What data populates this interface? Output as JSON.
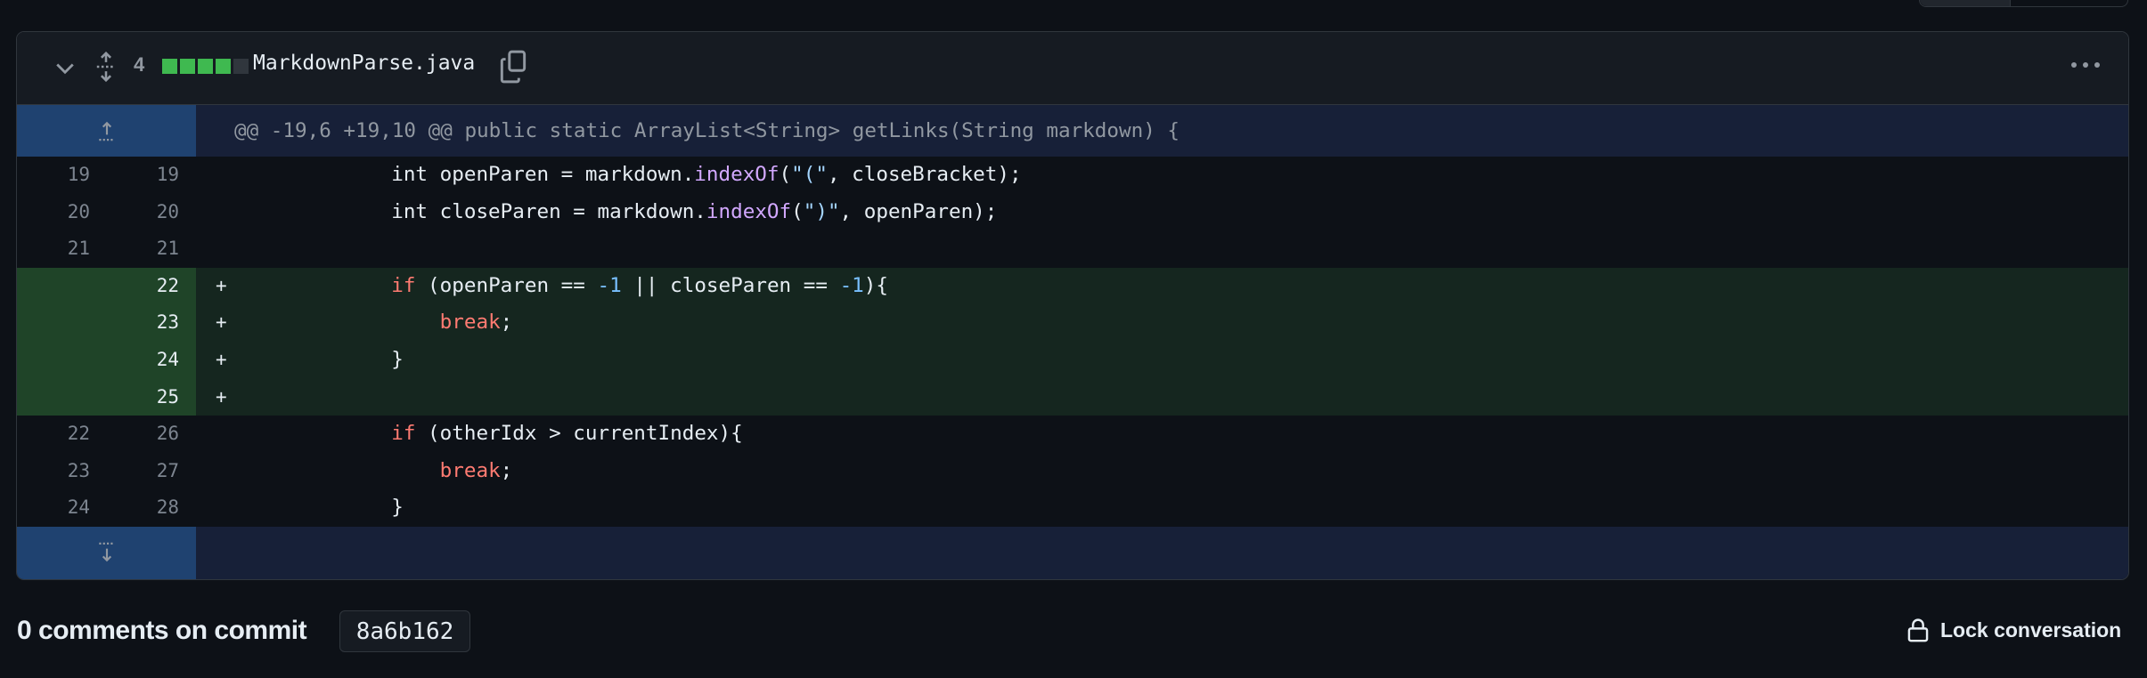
{
  "file": {
    "changes": "4",
    "diffstat": [
      "add",
      "add",
      "add",
      "add",
      "neutral"
    ],
    "name": "MarkdownParse.java",
    "icons": {
      "collapse": "chevron-down-icon",
      "expand": "unfold-icon",
      "copy": "copy-icon",
      "menu": "kebab-horizontal-icon"
    }
  },
  "hunk_header": "@@ -19,6 +19,10 @@ public static ArrayList<String> getLinks(String markdown) {",
  "lines": [
    {
      "old": "19",
      "new": "19",
      "type": "ctx",
      "marker": "",
      "tokens": [
        [
          "txt",
          "            int openParen = markdown."
        ],
        [
          "fn",
          "indexOf"
        ],
        [
          "txt",
          "("
        ],
        [
          "str",
          "\"(\""
        ],
        [
          "txt",
          ", closeBracket);"
        ]
      ]
    },
    {
      "old": "20",
      "new": "20",
      "type": "ctx",
      "marker": "",
      "tokens": [
        [
          "txt",
          "            int closeParen = markdown."
        ],
        [
          "fn",
          "indexOf"
        ],
        [
          "txt",
          "("
        ],
        [
          "str",
          "\")\""
        ],
        [
          "txt",
          ", openParen);"
        ]
      ]
    },
    {
      "old": "21",
      "new": "21",
      "type": "ctx",
      "marker": "",
      "tokens": [
        [
          "txt",
          ""
        ]
      ]
    },
    {
      "old": "",
      "new": "22",
      "type": "add",
      "marker": "+",
      "tokens": [
        [
          "txt",
          "            "
        ],
        [
          "kw",
          "if"
        ],
        [
          "txt",
          " (openParen == "
        ],
        [
          "num",
          "-1"
        ],
        [
          "txt",
          " || closeParen == "
        ],
        [
          "num",
          "-1"
        ],
        [
          "txt",
          "){"
        ]
      ]
    },
    {
      "old": "",
      "new": "23",
      "type": "add",
      "marker": "+",
      "tokens": [
        [
          "txt",
          "                "
        ],
        [
          "kw",
          "break"
        ],
        [
          "txt",
          ";"
        ]
      ]
    },
    {
      "old": "",
      "new": "24",
      "type": "add",
      "marker": "+",
      "tokens": [
        [
          "txt",
          "            }"
        ]
      ]
    },
    {
      "old": "",
      "new": "25",
      "type": "add",
      "marker": "+",
      "tokens": [
        [
          "txt",
          ""
        ]
      ]
    },
    {
      "old": "22",
      "new": "26",
      "type": "ctx",
      "marker": "",
      "tokens": [
        [
          "txt",
          "            "
        ],
        [
          "kw",
          "if"
        ],
        [
          "txt",
          " (otherIdx > currentIndex){"
        ]
      ]
    },
    {
      "old": "23",
      "new": "27",
      "type": "ctx",
      "marker": "",
      "tokens": [
        [
          "txt",
          "                "
        ],
        [
          "kw",
          "break"
        ],
        [
          "txt",
          ";"
        ]
      ]
    },
    {
      "old": "24",
      "new": "28",
      "type": "ctx",
      "marker": "",
      "tokens": [
        [
          "txt",
          "            }"
        ]
      ]
    }
  ],
  "footer": {
    "comments_label": "0 comments on commit",
    "commit_sha": "8a6b162",
    "lock_label": "Lock conversation"
  },
  "colors": {
    "add_square": "#3fb950",
    "neutral_square": "#30363d",
    "keyword": "#ff7b72",
    "function": "#d2a8ff",
    "string": "#a5d6ff",
    "constant": "#79c0ff"
  }
}
